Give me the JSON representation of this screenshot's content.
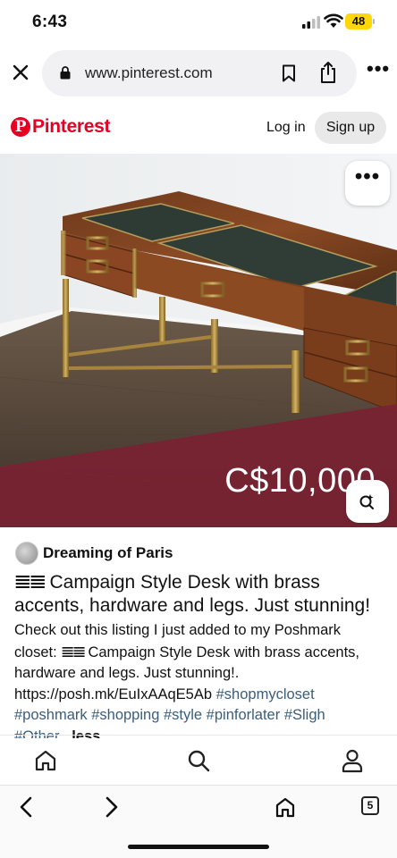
{
  "status_bar": {
    "time": "6:43",
    "battery": "48",
    "battery_color": "#ffd60a"
  },
  "browser": {
    "url": "www.pinterest.com",
    "icons": [
      "close-icon",
      "lock-icon",
      "bookmark-icon",
      "share-icon",
      "more-icon"
    ]
  },
  "pinterest_header": {
    "logo_letter": "P",
    "logo_text": "Pinterest",
    "login_label": "Log in",
    "signup_label": "Sign up",
    "brand_color": "#e60023"
  },
  "pin": {
    "price": "C$10,000",
    "creator_name": "Dreaming of Paris",
    "title_glyph": "𝌆𝌆",
    "title_text": " Campaign Style Desk with brass accents, hardware and legs. Just stunning!",
    "description": {
      "intro": "Check out this listing I just added to my Poshmark closet: ",
      "glyph": "𝌆𝌆",
      "body": " Campaign Style Desk with brass accents, hardware and legs. Just stunning!. https://posh.mk/EuIxAAqE5Ab ",
      "tags": [
        "#shopmycloset",
        "#poshmark",
        "#shopping",
        "#style",
        "#pinforlater",
        "#Sligh",
        "#Other"
      ],
      "less_label": "...less",
      "tag_color": "#3b5d7a"
    }
  },
  "bottom_nav": {
    "items": [
      "home-icon",
      "search-icon",
      "profile-icon"
    ]
  },
  "safari_toolbar": {
    "tab_count": "5",
    "items": [
      "back-icon",
      "forward-icon",
      "home-icon",
      "tabs-icon"
    ]
  }
}
